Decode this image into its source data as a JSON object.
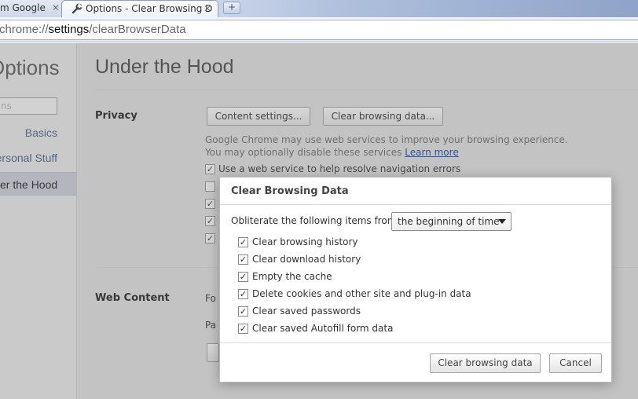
{
  "tabs": [
    {
      "title": "m Google",
      "close": "✕"
    },
    {
      "title": "Options - Clear Browsing D",
      "close": "✕"
    }
  ],
  "new_tab_label": "+",
  "address": {
    "scheme": "chrome://",
    "host": "settings",
    "path": "/clearBrowserData"
  },
  "nav": {
    "title": "Options",
    "search_placeholder": "ns",
    "items": [
      {
        "label": "Basics"
      },
      {
        "label": "ersonal Stuff"
      },
      {
        "label": "er the Hood"
      }
    ]
  },
  "main": {
    "title": "Under the Hood",
    "privacy_label": "Privacy",
    "content_settings_button": "Content settings...",
    "clear_browsing_button": "Clear browsing data...",
    "desc_line1": "Google Chrome may use web services to improve your browsing experience.",
    "desc_line2": "You may optionally disable these services",
    "learn_more": "Learn more",
    "nav_errors_label": "Use a web service to help resolve navigation errors",
    "web_content_label": "Web Content",
    "wc_fragment1": "Fo",
    "wc_fragment2": "Pa"
  },
  "dialog": {
    "title": "Clear Browsing Data",
    "obliterate_label": "Obliterate the following items from:",
    "time_range": "the beginning of time",
    "items": [
      {
        "label": "Clear browsing history",
        "checked": true
      },
      {
        "label": "Clear download history",
        "checked": true
      },
      {
        "label": "Empty the cache",
        "checked": true
      },
      {
        "label": "Delete cookies and other site and plug-in data",
        "checked": true
      },
      {
        "label": "Clear saved passwords",
        "checked": true
      },
      {
        "label": "Clear saved Autofill form data",
        "checked": true
      }
    ],
    "confirm_button": "Clear browsing data",
    "cancel_button": "Cancel"
  },
  "checkmark": "✓"
}
